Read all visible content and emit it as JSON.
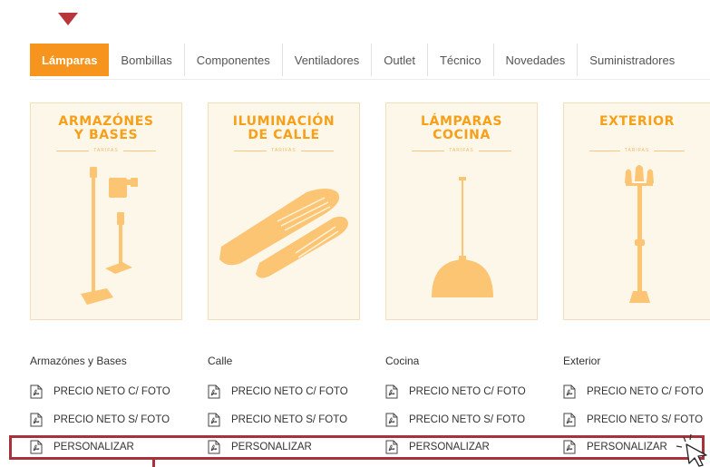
{
  "tabs": [
    {
      "label": "Lámparas",
      "active": true
    },
    {
      "label": "Bombillas",
      "active": false
    },
    {
      "label": "Componentes",
      "active": false
    },
    {
      "label": "Ventiladores",
      "active": false
    },
    {
      "label": "Outlet",
      "active": false
    },
    {
      "label": "Técnico",
      "active": false
    },
    {
      "label": "Novedades",
      "active": false
    },
    {
      "label": "Suministradores",
      "active": false
    }
  ],
  "cards": [
    {
      "title": "ARMAZÓNES\nY BASES",
      "subtitle": "TARIFAS",
      "image": "lamp-stands-icon"
    },
    {
      "title": "ILUMINACIÓN\nDE CALLE",
      "subtitle": "TARIFAS",
      "image": "street-light-icon"
    },
    {
      "title": "LÁMPARAS\nCOCINA",
      "subtitle": "TARIFAS",
      "image": "pendant-lamp-icon"
    },
    {
      "title": "EXTERIOR",
      "subtitle": "TARIFAS",
      "image": "lamp-post-icon"
    }
  ],
  "columns": [
    {
      "title": "Armazónes y Bases",
      "links": [
        "PRECIO NETO C/ FOTO",
        "PRECIO NETO S/ FOTO",
        "PERSONALIZAR"
      ]
    },
    {
      "title": "Calle",
      "links": [
        "PRECIO NETO C/ FOTO",
        "PRECIO NETO S/ FOTO",
        "PERSONALIZAR"
      ]
    },
    {
      "title": "Cocina",
      "links": [
        "PRECIO NETO C/ FOTO",
        "PRECIO NETO S/ FOTO",
        "PERSONALIZAR"
      ]
    },
    {
      "title": "Exterior",
      "links": [
        "PRECIO NETO C/ FOTO",
        "PRECIO NETO S/ FOTO",
        "PERSONALIZAR"
      ]
    }
  ],
  "colors": {
    "accent": "#f7941d",
    "illustration": "#fcc574",
    "card_bg": "#fdf7ea",
    "highlight": "#a8323a"
  }
}
